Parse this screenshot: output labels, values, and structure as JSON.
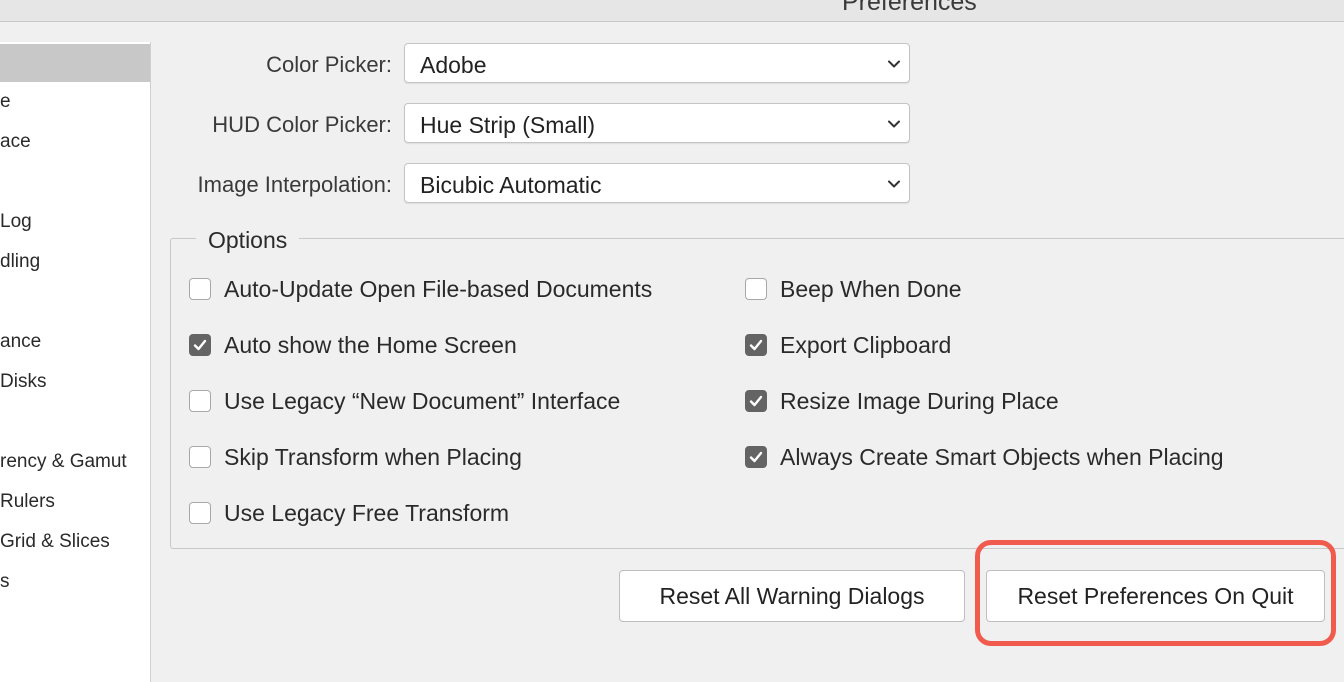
{
  "window": {
    "title": "Preferences"
  },
  "sidebar": {
    "items": [
      {
        "label": "e"
      },
      {
        "label": "ace"
      },
      {
        "label": "Log"
      },
      {
        "label": "dling"
      },
      {
        "label": "ance"
      },
      {
        "label": "Disks"
      },
      {
        "label": "rency & Gamut"
      },
      {
        "label": "Rulers"
      },
      {
        "label": "Grid & Slices"
      },
      {
        "label": "s"
      }
    ]
  },
  "fields": {
    "color_picker": {
      "label": "Color Picker:",
      "value": "Adobe"
    },
    "hud_color_picker": {
      "label": "HUD Color Picker:",
      "value": "Hue Strip (Small)"
    },
    "image_interpolation": {
      "label": "Image Interpolation:",
      "value": "Bicubic Automatic"
    }
  },
  "options": {
    "legend": "Options",
    "left": [
      {
        "label": "Auto-Update Open File-based Documents",
        "checked": false
      },
      {
        "label": "Auto show the Home Screen",
        "checked": true
      },
      {
        "label": "Use Legacy “New Document” Interface",
        "checked": false
      },
      {
        "label": "Skip Transform when Placing",
        "checked": false
      },
      {
        "label": "Use Legacy Free Transform",
        "checked": false
      }
    ],
    "right": [
      {
        "label": "Beep When Done",
        "checked": false
      },
      {
        "label": "Export Clipboard",
        "checked": true
      },
      {
        "label": "Resize Image During Place",
        "checked": true
      },
      {
        "label": "Always Create Smart Objects when Placing",
        "checked": true
      }
    ]
  },
  "buttons": {
    "reset_warnings": "Reset All Warning Dialogs",
    "reset_prefs": "Reset Preferences On Quit"
  },
  "colors": {
    "highlight": "#f15b4e",
    "checked": "#646464"
  },
  "icons": {
    "dropdown": "chevron-down-icon",
    "check": "checkmark-icon"
  }
}
